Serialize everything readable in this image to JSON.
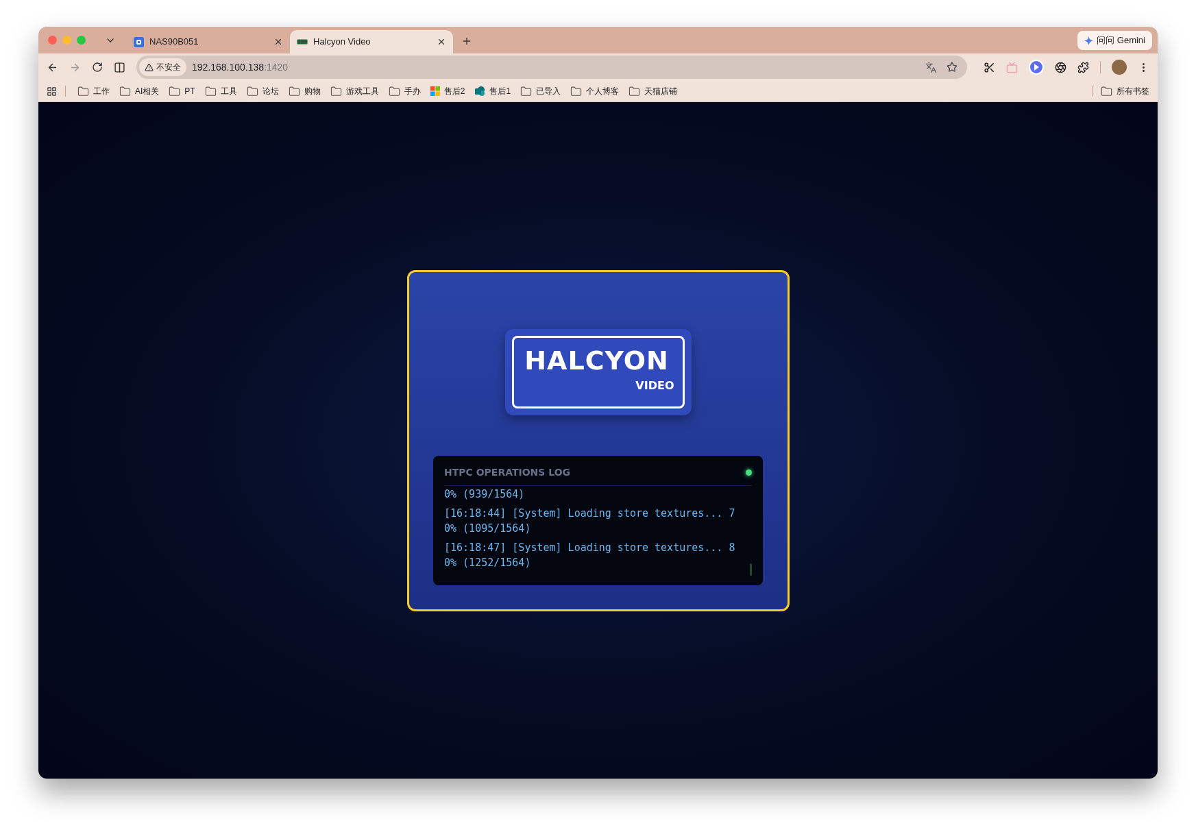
{
  "browser": {
    "tabs": [
      {
        "title": "NAS90B051",
        "selected": false
      },
      {
        "title": "Halcyon Video",
        "selected": true
      }
    ],
    "gemini_button": "问问 Gemini",
    "address_bar": {
      "security": "不安全",
      "host": "192.168.100.138",
      "port": ":1420"
    },
    "bookmarks": [
      {
        "label": "工作",
        "kind": "folder"
      },
      {
        "label": "AI相关",
        "kind": "folder"
      },
      {
        "label": "PT",
        "kind": "folder"
      },
      {
        "label": "工具",
        "kind": "folder"
      },
      {
        "label": "论坛",
        "kind": "folder"
      },
      {
        "label": "购物",
        "kind": "folder"
      },
      {
        "label": "游戏工具",
        "kind": "folder"
      },
      {
        "label": "手办",
        "kind": "folder"
      },
      {
        "label": "售后2",
        "kind": "tiles"
      },
      {
        "label": "售后1",
        "kind": "app"
      },
      {
        "label": "已导入",
        "kind": "folder"
      },
      {
        "label": "个人博客",
        "kind": "folder"
      },
      {
        "label": "天猫店铺",
        "kind": "folder"
      }
    ],
    "all_bookmarks": "所有书签"
  },
  "page": {
    "logo": {
      "title": "HALCYON",
      "subtitle": "VIDEO"
    },
    "log": {
      "title": "HTPC OPERATIONS LOG",
      "live": true,
      "entries": [
        {
          "text": "0% (939/1564)"
        },
        {
          "text": "[16:18:44] [System] Loading store textures... 70% (1095/1564)"
        },
        {
          "text": "[16:18:47] [System] Loading store textures... 80% (1252/1564)"
        }
      ]
    }
  }
}
